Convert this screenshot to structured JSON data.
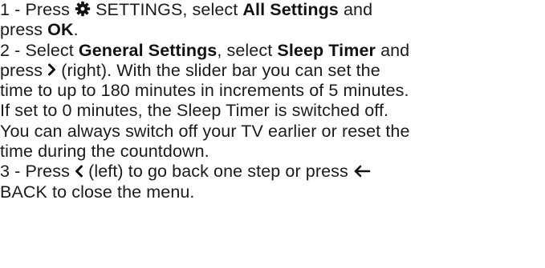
{
  "steps": [
    {
      "number": "1 -",
      "lines": [
        {
          "t1": "Press",
          "icon": "gear-icon",
          "t2": "SETTINGS, select",
          "b1": "All Settings",
          "t3": "and"
        },
        {
          "t1": "press",
          "b1": "OK",
          "t2": "."
        }
      ]
    },
    {
      "number": "2 -",
      "lines": [
        {
          "t1": "Select",
          "b1": "General Settings",
          "t2": ", select",
          "b2": "Sleep Timer",
          "t3": "and"
        },
        {
          "t1": "press",
          "icon": "chevron-right-icon",
          "t2": "(right). With the slider bar you can set the"
        },
        {
          "t1": "time to up to 180 minutes in increments of 5 minutes."
        },
        {
          "t1": "If set to 0 minutes, the Sleep Timer is switched off."
        },
        {
          "t1": "You can always switch off your TV earlier or reset the"
        },
        {
          "t1": "time during the countdown."
        }
      ]
    },
    {
      "number": "3 -",
      "lines": [
        {
          "t1": "Press",
          "icon": "chevron-left-icon",
          "t2": "(left) to go back one step or press",
          "icon2": "back-arrow-icon"
        },
        {
          "t1": "BACK to close the menu."
        }
      ]
    }
  ],
  "colors": {
    "text": "#1b1b1b",
    "bold": "#111111",
    "icon": "#111111"
  }
}
